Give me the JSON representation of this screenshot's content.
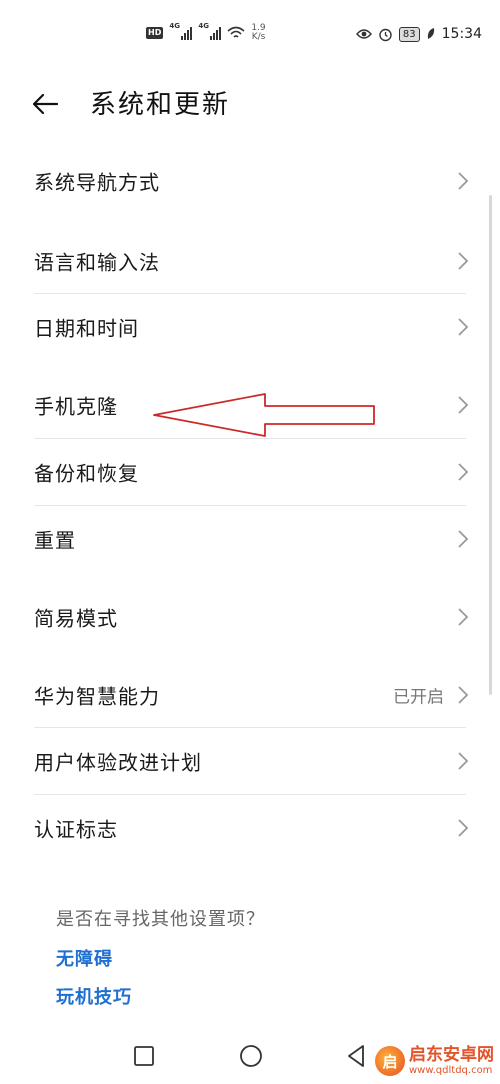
{
  "status_bar": {
    "hd": "HD",
    "net1": "4G",
    "net2": "4G",
    "speed_value": "1.9",
    "speed_unit": "K/s",
    "battery": "83",
    "time": "15:34"
  },
  "header": {
    "title": "系统和更新"
  },
  "settings": [
    {
      "label": "系统导航方式",
      "value": ""
    },
    {
      "label": "语言和输入法",
      "value": ""
    },
    {
      "label": "日期和时间",
      "value": ""
    },
    {
      "label": "手机克隆",
      "value": ""
    },
    {
      "label": "备份和恢复",
      "value": ""
    },
    {
      "label": "重置",
      "value": ""
    },
    {
      "label": "简易模式",
      "value": ""
    },
    {
      "label": "华为智慧能力",
      "value": "已开启"
    },
    {
      "label": "用户体验改进计划",
      "value": ""
    },
    {
      "label": "认证标志",
      "value": ""
    }
  ],
  "suggestions": {
    "title": "是否在寻找其他设置项？",
    "links": [
      "无障碍",
      "玩机技巧"
    ]
  },
  "watermark": {
    "logo_char": "启",
    "name": "启东安卓网",
    "url": "www.qdltdq.com"
  },
  "colors": {
    "link": "#1f6fd0",
    "annotation": "#cc2a2a",
    "watermark": "#e2542a"
  }
}
